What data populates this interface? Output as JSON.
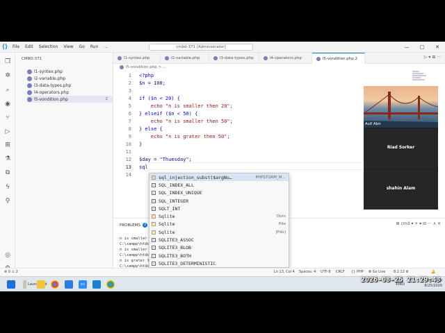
{
  "window": {
    "menu": [
      "File",
      "Edit",
      "Selection",
      "View",
      "Go",
      "Run",
      "..."
    ],
    "search": "cmbd-371 [Administrator]",
    "controls": [
      "—",
      "□",
      "✕"
    ]
  },
  "explorer": {
    "title": "CMBD-371",
    "files": [
      {
        "name": "l1-syntex.php",
        "count": ""
      },
      {
        "name": "l2-variable.php",
        "count": ""
      },
      {
        "name": "l3-data-types.php",
        "count": ""
      },
      {
        "name": "l4-operators.php",
        "count": ""
      },
      {
        "name": "l5-vondition.php",
        "count": "2"
      }
    ]
  },
  "tabs": [
    {
      "label": "l1-syntex.php"
    },
    {
      "label": "l2-variable.php"
    },
    {
      "label": "l3-data-types.php"
    },
    {
      "label": "l4-operators.php"
    },
    {
      "label": "l5-vondition.php 2"
    }
  ],
  "tab_actions": "▷ ▾  ⊞ ···",
  "breadcrumb": "l5-vondition.php > ...",
  "editor": {
    "lines": [
      {
        "n": "1",
        "text": "<?php"
      },
      {
        "n": "2",
        "text": "$n = 100;"
      },
      {
        "n": "3",
        "text": ""
      },
      {
        "n": "4",
        "text": "if ($n < 20) {"
      },
      {
        "n": "5",
        "text": "    echo \"n is smaller then 20\";"
      },
      {
        "n": "6",
        "text": "} elseif ($n < 50) {"
      },
      {
        "n": "7",
        "text": "    echo \"n is smaller then 50\";"
      },
      {
        "n": "8",
        "text": "} else {"
      },
      {
        "n": "9",
        "text": "    echo \"n is grater then 50\";"
      },
      {
        "n": "10",
        "text": "}"
      },
      {
        "n": "11",
        "text": ""
      },
      {
        "n": "12",
        "text": "$day = \"Thuesday\";"
      },
      {
        "n": "13",
        "text": "sql"
      },
      {
        "n": "14",
        "text": ""
      }
    ]
  },
  "suggestions": [
    {
      "label": "sql_injection_subst($argNu…",
      "detail": "PHPSTORM_M…",
      "kind": "fn"
    },
    {
      "label": "SQL_INDEX_ALL",
      "detail": "",
      "kind": "const"
    },
    {
      "label": "SQL_INDEX_UNIQUE",
      "detail": "",
      "kind": "const"
    },
    {
      "label": "SQL_INTEGER",
      "detail": "",
      "kind": "const"
    },
    {
      "label": "SQLT_INT",
      "detail": "",
      "kind": "const"
    },
    {
      "label": "Sqlite",
      "detail": "Dom",
      "kind": "fn"
    },
    {
      "label": "Sqlite",
      "detail": "Pdo",
      "kind": "fn"
    },
    {
      "label": "Sqlite",
      "detail": "[Pdo]",
      "kind": "fn"
    },
    {
      "label": "SQLITE3_ASSOC",
      "detail": "",
      "kind": "const"
    },
    {
      "label": "SQLITE3_BLOB",
      "detail": "",
      "kind": "const"
    },
    {
      "label": "SQLITE3_BOTH",
      "detail": "",
      "kind": "const"
    },
    {
      "label": "SQLITE3_DETERMINISTIC",
      "detail": "",
      "kind": "const"
    }
  ],
  "panel": {
    "tab": "PROBLEMS",
    "badge": "2",
    "tools": "⊞ cmd ▾ + ▾ ⊟ ··· ∧ ✕",
    "terminal": [
      "n is smaller",
      "C:\\xampp\\htdo",
      "n is smaller",
      "C:\\xampp\\htdo",
      "n is grater t",
      "C:\\xampp\\htdo"
    ]
  },
  "status": {
    "left": "⊗ 0 ⚠ 2",
    "items": [
      "Ln 13, Col 4",
      "Spaces: 4",
      "UTF-8",
      "CRLF",
      "{} PHP",
      "⦾ Go Live",
      "8.2.12 ⚙",
      "🔔"
    ]
  },
  "taskbar": {
    "items": [
      "Launchpad",
      "Bootstrap v5.3.8"
    ],
    "sys": "ENG",
    "time": "9:29 PM",
    "date": "8/25/2026"
  },
  "video": {
    "participants": [
      "Asif Abir",
      "Riad Sorker",
      "shahin Alam"
    ]
  },
  "overlay_clock": "2026-08-25 21:29:43",
  "colors": {
    "accent": "#0a7bd4",
    "keyword": "#0000ff",
    "string": "#a31515",
    "number": "#098658",
    "variable": "#001080"
  }
}
